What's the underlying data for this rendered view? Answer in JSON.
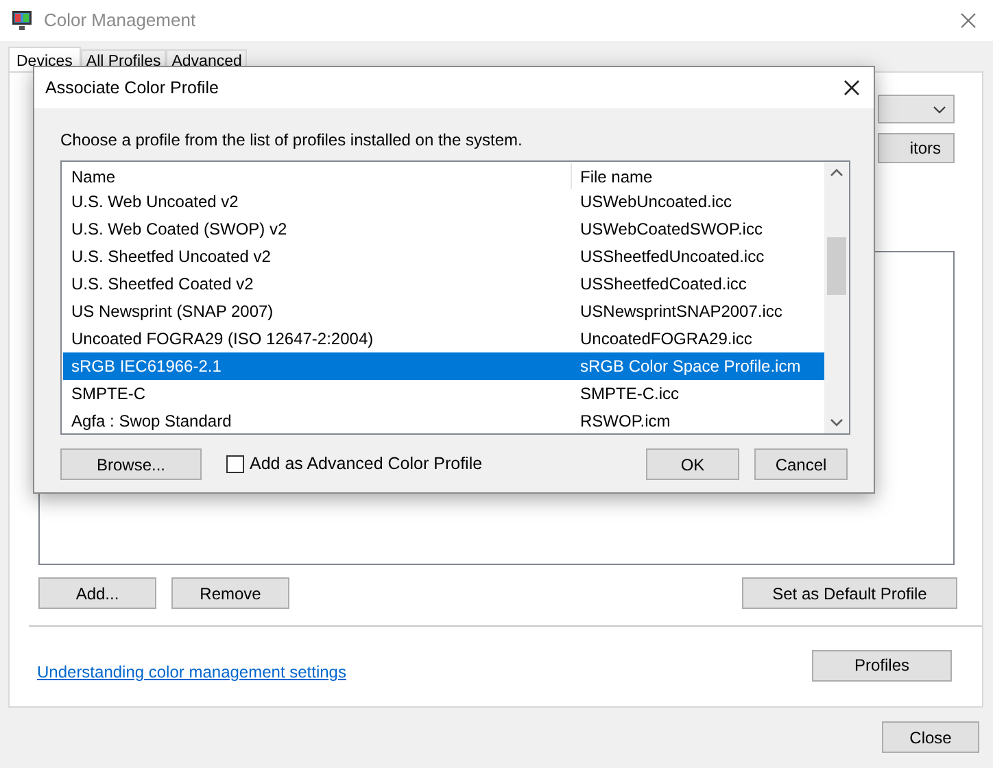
{
  "window": {
    "title": "Color Management"
  },
  "tabs": [
    {
      "label": "Devices",
      "selected": true
    },
    {
      "label": "All Profiles",
      "selected": false
    },
    {
      "label": "Advanced",
      "selected": false
    }
  ],
  "devices_tab": {
    "partial_button": "itors",
    "buttons": [
      "Add...",
      "Remove"
    ],
    "default_button": "Set as Default Profile",
    "link": "Understanding color management settings",
    "profiles_button": "Profiles"
  },
  "close_button": "Close",
  "dialog": {
    "title": "Associate Color Profile",
    "instruction": "Choose a profile from the list of profiles installed on the system.",
    "columns": [
      "Name",
      "File name"
    ],
    "rows": [
      {
        "name": "U.S. Web Uncoated v2",
        "file": "USWebUncoated.icc",
        "selected": false
      },
      {
        "name": "U.S. Web Coated (SWOP) v2",
        "file": "USWebCoatedSWOP.icc",
        "selected": false
      },
      {
        "name": "U.S. Sheetfed Uncoated v2",
        "file": "USSheetfedUncoated.icc",
        "selected": false
      },
      {
        "name": "U.S. Sheetfed Coated v2",
        "file": "USSheetfedCoated.icc",
        "selected": false
      },
      {
        "name": "US Newsprint (SNAP 2007)",
        "file": "USNewsprintSNAP2007.icc",
        "selected": false
      },
      {
        "name": "Uncoated FOGRA29 (ISO 12647-2:2004)",
        "file": "UncoatedFOGRA29.icc",
        "selected": false
      },
      {
        "name": "sRGB IEC61966-2.1",
        "file": "sRGB Color Space Profile.icm",
        "selected": true
      },
      {
        "name": "SMPTE-C",
        "file": "SMPTE-C.icc",
        "selected": false
      },
      {
        "name": "Agfa : Swop Standard",
        "file": "RSWOP.icm",
        "selected": false
      }
    ],
    "browse_button": "Browse...",
    "advanced_checkbox": {
      "label": "Add as Advanced Color Profile",
      "checked": false
    },
    "ok_button": "OK",
    "cancel_button": "Cancel"
  }
}
